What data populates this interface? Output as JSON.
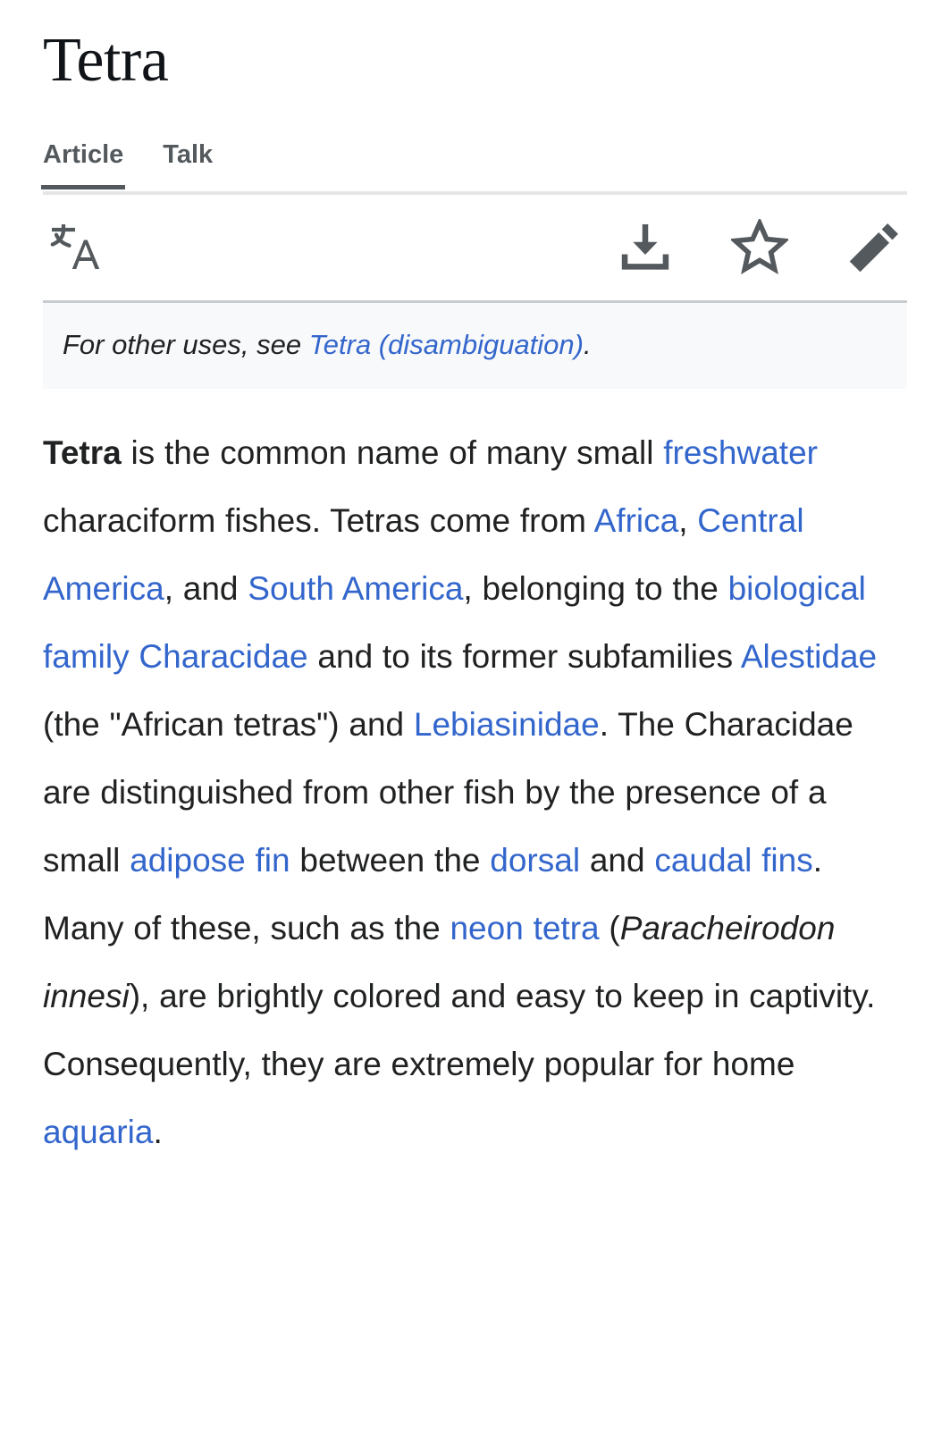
{
  "article": {
    "title": "Tetra"
  },
  "tabs": [
    {
      "label": "Article",
      "active": true,
      "name": "tab-article"
    },
    {
      "label": "Talk",
      "active": false,
      "name": "tab-talk"
    }
  ],
  "toolbar": {
    "language_icon": "language-icon",
    "download_icon": "download-icon",
    "watch_star_icon": "star-outline-icon",
    "edit_pencil_icon": "pencil-edit-icon"
  },
  "hatnote": {
    "prefix": "For other uses, see ",
    "link": "Tetra (disambiguation)",
    "suffix": "."
  },
  "lead": {
    "t1": "Tetra",
    "t2": " is the common name of many small ",
    "l1": "freshwater",
    "t3": " characiform fishes. Tetras come from ",
    "l2": "Africa",
    "t4": ", ",
    "l3": "Central America",
    "t5": ", and ",
    "l4": "South America",
    "t6": ", belonging to the ",
    "l5": "biological family",
    "t7": " ",
    "l6": "Characidae",
    "t8": " and to its former subfamilies ",
    "l7": "Alestidae",
    "t9": " (the \"African tetras\") and ",
    "l8": "Lebiasinidae",
    "t10": ". The Characidae are distinguished from other fish by the presence of a small ",
    "l9": "adipose fin",
    "t11": " between the ",
    "l10": "dorsal",
    "t12": " and ",
    "l11": "caudal fins",
    "t13": ". Many of these, such as the ",
    "l12": "neon tetra",
    "t14": " (",
    "i1": "Paracheirodon innesi",
    "t15": "), are brightly colored and easy to keep in captivity. Consequently, they are extremely popular for home ",
    "l13": "aquaria",
    "t16": "."
  },
  "colors": {
    "link": "#3366cc",
    "text": "#202122",
    "title": "#101418",
    "tab": "#54595d",
    "hatnote_bg": "#f8f9fa",
    "hatnote_border": "#c8ccd1",
    "tab_border": "#e4e6e8"
  }
}
